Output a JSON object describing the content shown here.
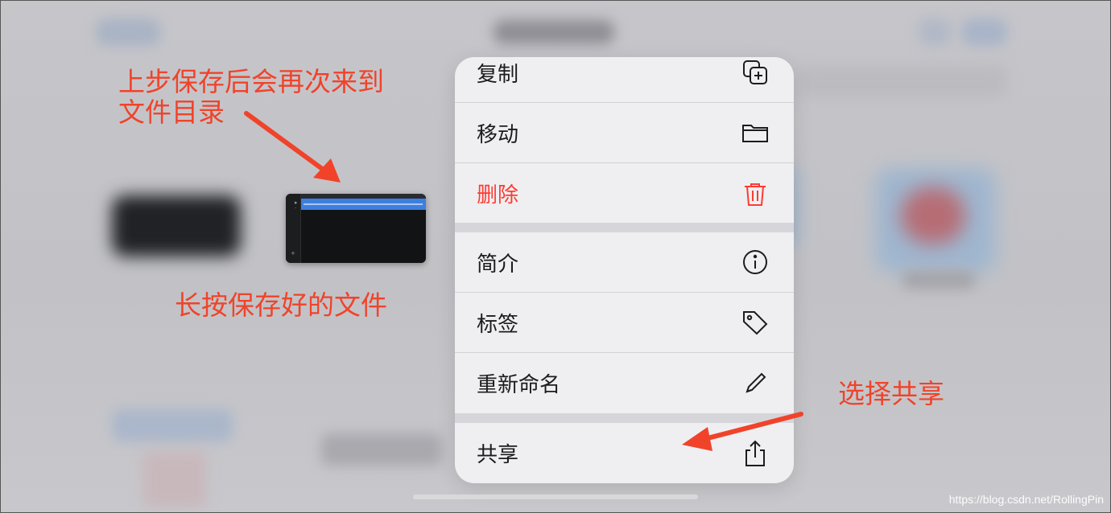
{
  "menu": {
    "items": [
      {
        "label": "复制",
        "icon": "duplicate-icon"
      },
      {
        "label": "移动",
        "icon": "folder-icon"
      },
      {
        "label": "删除",
        "icon": "trash-icon"
      },
      {
        "label": "简介",
        "icon": "info-icon"
      },
      {
        "label": "标签",
        "icon": "tag-icon"
      },
      {
        "label": "重新命名",
        "icon": "pencil-icon"
      },
      {
        "label": "共享",
        "icon": "share-icon"
      }
    ],
    "destructive_color": "#ff3b30"
  },
  "annotations": {
    "note_top_line1": "上步保存后会再次来到",
    "note_top_line2": "文件目录",
    "note_file": "长按保存好的文件",
    "note_share": "选择共享",
    "color": "#f0432a"
  },
  "watermark": "https://blog.csdn.net/RollingPin"
}
